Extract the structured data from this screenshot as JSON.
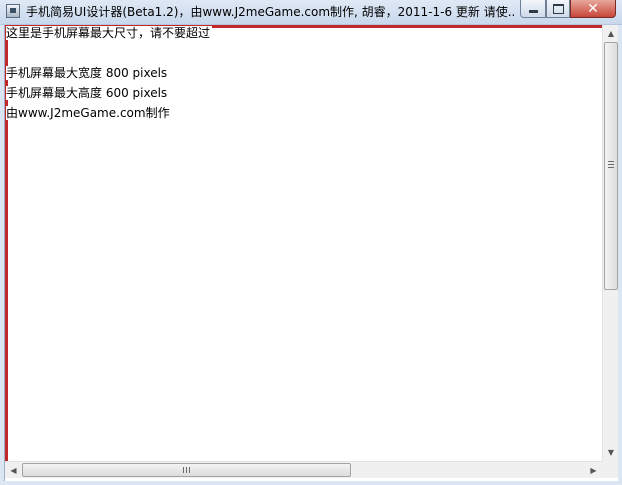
{
  "window": {
    "title": "手机简易UI设计器(Beta1.2)，由www.J2meGame.com制作, 胡睿，2011-1-6 更新   请使..."
  },
  "controls": {
    "minimize_icon": "minimize-icon",
    "maximize_icon": "maximize-icon",
    "close_icon": "close-icon",
    "close_glyph": "✕"
  },
  "canvas": {
    "lines": [
      "这里是手机屏幕最大尺寸，请不要超过",
      "手机屏幕最大宽度 800 pixels",
      "手机屏幕最大高度 600 pixels",
      "由www.J2meGame.com制作"
    ],
    "frame_color": "#c0282a"
  },
  "scrollbars": {
    "up_arrow": "▲",
    "down_arrow": "▼",
    "left_arrow": "◀",
    "right_arrow": "▶"
  }
}
